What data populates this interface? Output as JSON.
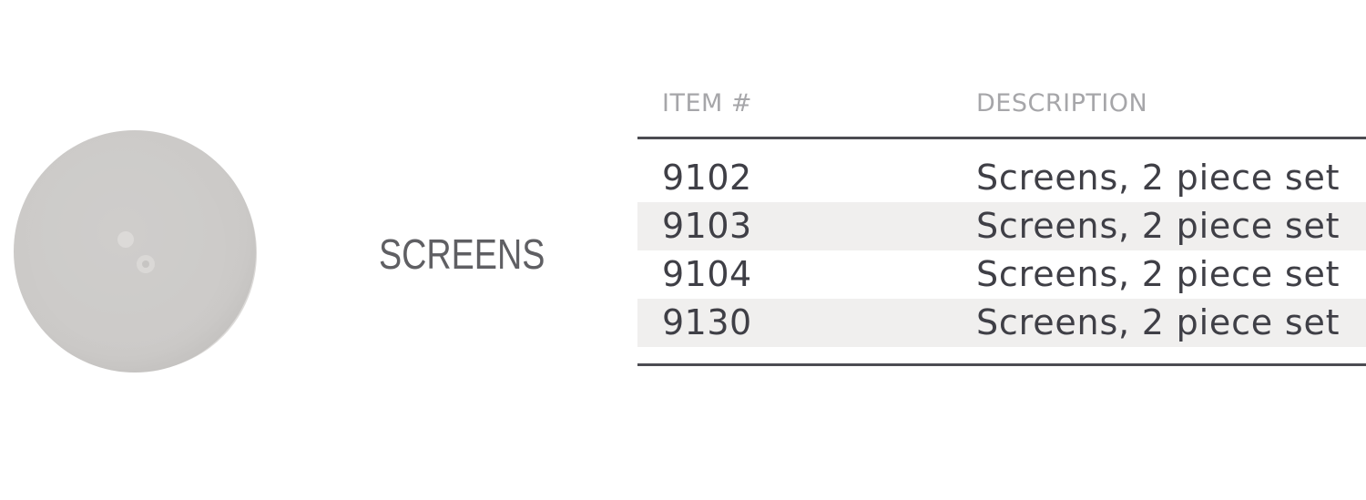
{
  "product": {
    "name": "SCREENS",
    "image_icon": "round-screen-disc-image"
  },
  "table": {
    "headers": {
      "item": "ITEM #",
      "description": "DESCRIPTION"
    },
    "rows": [
      {
        "item": "9102",
        "description": "Screens, 2 piece set"
      },
      {
        "item": "9103",
        "description": "Screens, 2 piece set"
      },
      {
        "item": "9104",
        "description": "Screens, 2 piece set"
      },
      {
        "item": "9130",
        "description": "Screens, 2 piece set"
      }
    ]
  },
  "colors": {
    "text_dark": "#3f3f46",
    "header_text": "#a6a6a9",
    "rule": "#4c4c52",
    "row_shade": "#f0efee",
    "disc": "#cfcdcb"
  }
}
